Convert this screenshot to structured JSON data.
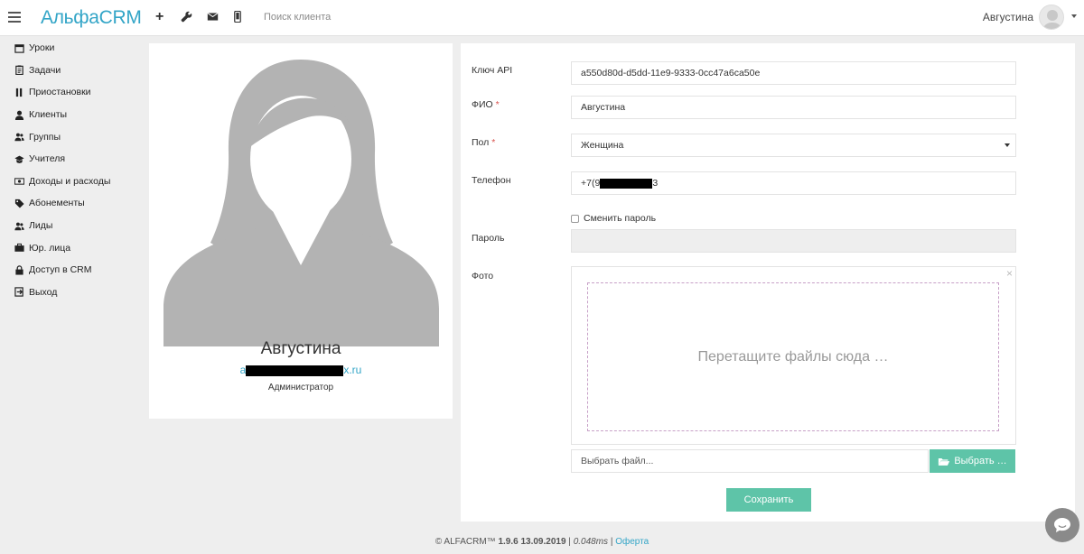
{
  "header": {
    "logo": "АльфаCRM",
    "search_placeholder": "Поиск клиента",
    "user_name": "Августина",
    "icons": [
      "menu-icon",
      "plus-icon",
      "wrench-icon",
      "mail-icon",
      "mobile-icon"
    ]
  },
  "sidebar": {
    "items": [
      {
        "label": "Уроки",
        "icon": "calendar-icon"
      },
      {
        "label": "Задачи",
        "icon": "clipboard-icon"
      },
      {
        "label": "Приостановки",
        "icon": "pause-icon"
      },
      {
        "label": "Клиенты",
        "icon": "user-icon"
      },
      {
        "label": "Группы",
        "icon": "users-icon"
      },
      {
        "label": "Учителя",
        "icon": "graduation-cap-icon"
      },
      {
        "label": "Доходы и расходы",
        "icon": "money-icon"
      },
      {
        "label": "Абонементы",
        "icon": "tag-icon"
      },
      {
        "label": "Лиды",
        "icon": "users-icon"
      },
      {
        "label": "Юр. лица",
        "icon": "briefcase-icon"
      },
      {
        "label": "Доступ в CRM",
        "icon": "lock-icon"
      },
      {
        "label": "Выход",
        "icon": "sign-out-icon"
      }
    ]
  },
  "profile": {
    "name": "Августина",
    "email_visible_start": "a",
    "email_visible_end": "x.ru",
    "role": "Администратор"
  },
  "form": {
    "api_key_label": "Ключ API",
    "api_key_value": "a550d80d-d5dd-11e9-9333-0cc47a6ca50e",
    "fio_label": "ФИО",
    "fio_value": "Августина",
    "gender_label": "Пол",
    "gender_value": "Женщина",
    "phone_label": "Телефон",
    "phone_prefix": "+7(9",
    "phone_suffix": "3",
    "change_password_label": "Сменить пароль",
    "password_label": "Пароль",
    "photo_label": "Фото",
    "required_mark": "*",
    "drop_text": "Перетащите файлы сюда …",
    "close_symbol": "×",
    "file_placeholder": "Выбрать файл...",
    "browse_label": "Выбрать …",
    "save_label": "Сохранить"
  },
  "footer": {
    "brand": "© ALFACRM™",
    "version": "1.9.6",
    "date": "13.09.2019",
    "time": "0.048ms",
    "offer_link": "Оферта"
  },
  "colors": {
    "accent": "#33a5c7",
    "button": "#5ec4a8",
    "background": "#eeeeee"
  }
}
